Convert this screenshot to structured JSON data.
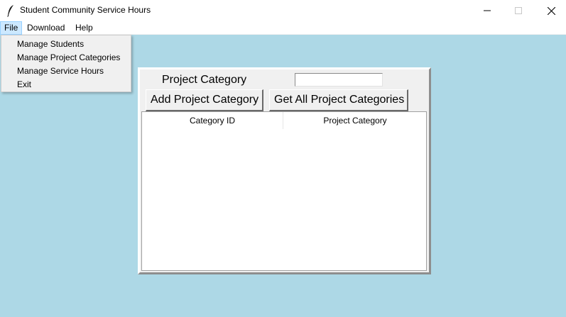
{
  "window": {
    "title": "Student Community Service Hours"
  },
  "menubar": {
    "items": [
      {
        "label": "File"
      },
      {
        "label": "Download"
      },
      {
        "label": "Help"
      }
    ]
  },
  "file_menu": {
    "items": [
      {
        "label": "Manage Students"
      },
      {
        "label": "Manage Project Categories"
      },
      {
        "label": "Manage Service Hours"
      },
      {
        "label": "Exit"
      }
    ]
  },
  "form": {
    "category_label": "Project Category",
    "category_value": "",
    "add_button": "Add Project Category",
    "get_button": "Get All Project Categories"
  },
  "table": {
    "columns": [
      "Category ID",
      "Project Category"
    ],
    "rows": []
  },
  "colors": {
    "background": "#add8e6",
    "menu_highlight": "#cce8ff",
    "panel": "#f0f0f0"
  }
}
